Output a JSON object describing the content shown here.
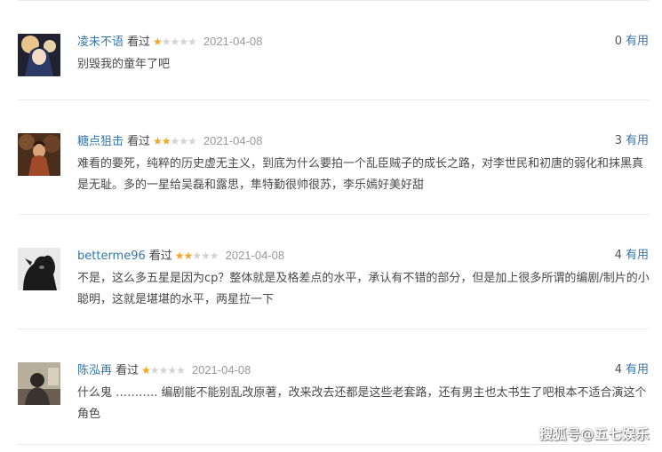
{
  "reviews": [
    {
      "user": "凌未不语",
      "watched": "看过",
      "rating": 1,
      "date": "2021-04-08",
      "votes": "0",
      "useful": "有用",
      "content": "别毁我的童年了吧",
      "avatar_colors": [
        "#1c1d2c",
        "#e8c9a0",
        "#4a5a8a"
      ]
    },
    {
      "user": "糖点狙击",
      "watched": "看过",
      "rating": 2,
      "date": "2021-04-08",
      "votes": "3",
      "useful": "有用",
      "content": "难看的要死，纯粹的历史虚无主义，到底为什么要拍一个乱臣贼子的成长之路，对李世民和初唐的弱化和抹黑真是无耻。多的一星给吴磊和露思，隼特勤很帅很苏，李乐嫣好美好甜",
      "avatar_colors": [
        "#5a3a22",
        "#c98b5a",
        "#8a5a38"
      ]
    },
    {
      "user": "betterme96",
      "watched": "看过",
      "rating": 2,
      "date": "2021-04-08",
      "votes": "4",
      "useful": "有用",
      "content": "不是，这么多五星是因为cp？整体就是及格差点的水平，承认有不错的部分，但是加上很多所谓的编剧/制片的小聪明，这就是堪堪的水平，两星拉一下",
      "avatar_colors": [
        "#e8e8e8",
        "#1a1a1a",
        "#555555"
      ]
    },
    {
      "user": "陈泓再",
      "watched": "看过",
      "rating": 1,
      "date": "2021-04-08",
      "votes": "4",
      "useful": "有用",
      "content": "什么鬼 ……….. 编剧能不能别乱改原著，改来改去还都是这些老套路，还有男主也太书生了吧根本不适合演这个角色",
      "avatar_colors": [
        "#8a8070",
        "#2a2622",
        "#c8bca8"
      ]
    }
  ],
  "watermark": "搜狐号@五七娱乐"
}
